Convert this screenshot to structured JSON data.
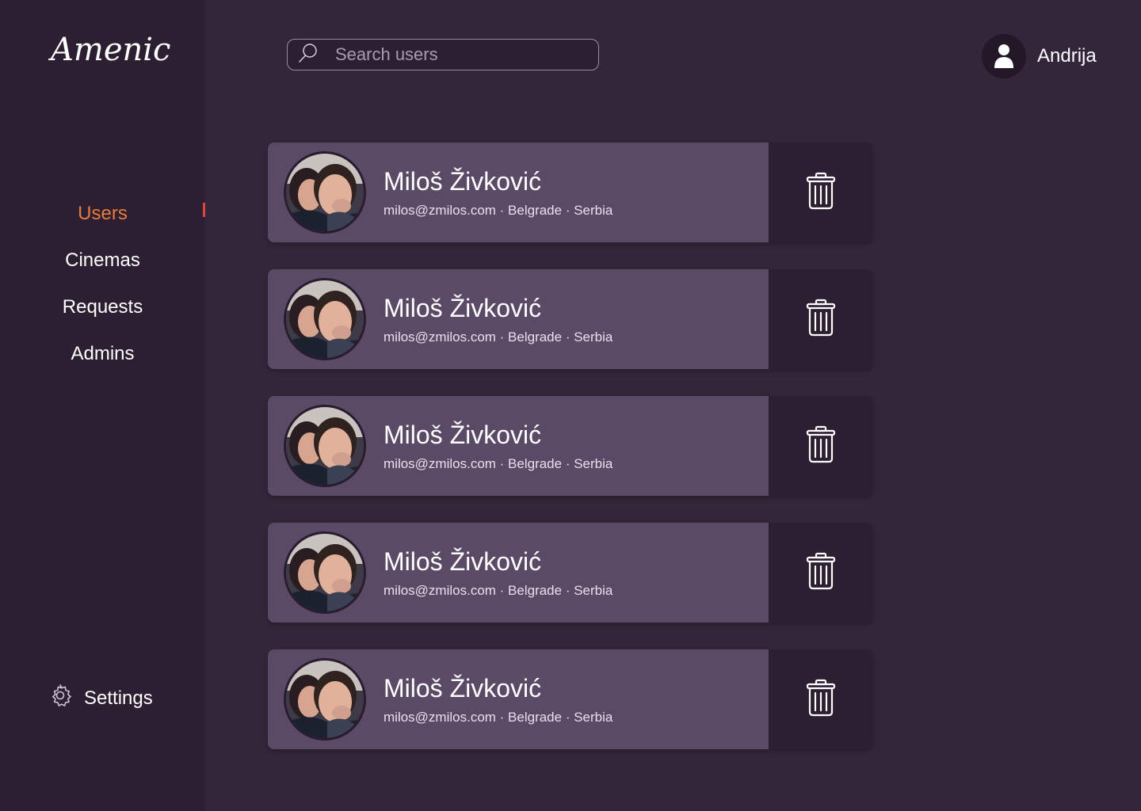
{
  "app": {
    "logo": "Amenic"
  },
  "sidebar": {
    "items": [
      {
        "label": "Users",
        "active": true
      },
      {
        "label": "Cinemas",
        "active": false
      },
      {
        "label": "Requests",
        "active": false
      },
      {
        "label": "Admins",
        "active": false
      }
    ],
    "settings_label": "Settings",
    "settings_icon": "gear-icon"
  },
  "search": {
    "placeholder": "Search users",
    "value": "",
    "icon": "search-icon"
  },
  "profile": {
    "name": "Andrija",
    "icon": "user-icon"
  },
  "users": [
    {
      "name": "Miloš Živković",
      "meta": "milos@zmilos.com · Belgrade · Serbia",
      "delete_icon": "trash-icon"
    },
    {
      "name": "Miloš Živković",
      "meta": "milos@zmilos.com · Belgrade · Serbia",
      "delete_icon": "trash-icon"
    },
    {
      "name": "Miloš Živković",
      "meta": "milos@zmilos.com · Belgrade · Serbia",
      "delete_icon": "trash-icon"
    },
    {
      "name": "Miloš Živković",
      "meta": "milos@zmilos.com · Belgrade · Serbia",
      "delete_icon": "trash-icon"
    },
    {
      "name": "Miloš Živković",
      "meta": "milos@zmilos.com · Belgrade · Serbia",
      "delete_icon": "trash-icon"
    }
  ],
  "colors": {
    "background": "#34263a",
    "sidebar": "#2c1f32",
    "card": "#5b4a66",
    "accent": "#e87b3c",
    "indicator": "#e2453b"
  }
}
